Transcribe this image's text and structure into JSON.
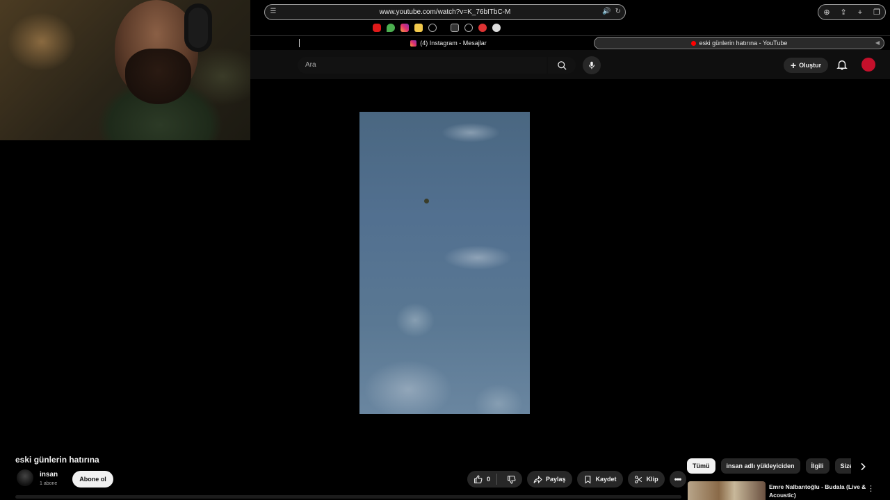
{
  "browser": {
    "url": "www.youtube.com/watch?v=K_76bITbC-M",
    "tabs": [
      {
        "label": "(4) Instagram - Mesajlar",
        "active": false
      },
      {
        "label": "eski günlerin hatırına - YouTube",
        "active": true
      }
    ],
    "favorites": [
      "youtube",
      "leaf",
      "instagram",
      "notes",
      "globe",
      "T",
      "globe",
      "red",
      "chrome"
    ]
  },
  "youtube": {
    "search_placeholder": "Ara",
    "create_label": "Oluştur",
    "video_title": "eski günlerin hatırına",
    "channel": {
      "name": "insan",
      "subscribers": "1 abone",
      "subscribe_label": "Abone ol"
    },
    "actions": {
      "like_count": "0",
      "share_label": "Paylaş",
      "save_label": "Kaydet",
      "clip_label": "Klip"
    },
    "chips": [
      "Tümü",
      "insan adlı yükleyiciden",
      "İlgili",
      "Size ö"
    ],
    "recommendation": {
      "title": "Emre Nalbantoğlu - Budala (Live & Acoustic)"
    }
  }
}
